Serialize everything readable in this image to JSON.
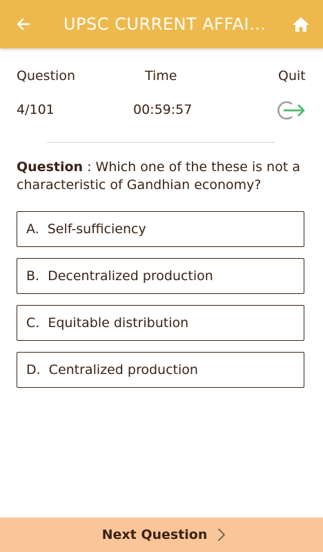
{
  "appbar": {
    "title": "UPSC CURRENT AFFAI...",
    "back_icon": "arrow-left-icon",
    "home_icon": "home-icon"
  },
  "stats": {
    "question_label": "Question",
    "time_label": "Time",
    "quit_label": "Quit",
    "question_value": "4/101",
    "time_value": "00:59:57",
    "quit_icon": "exit-arrow-icon"
  },
  "question": {
    "label": "Question",
    "separator": " : ",
    "text": "Which one of the these is not a characteristic of Gandhian economy?"
  },
  "options": [
    {
      "letter": "A.",
      "text": "Self-sufficiency"
    },
    {
      "letter": "B.",
      "text": "Decentralized production"
    },
    {
      "letter": "C.",
      "text": "Equitable distribution"
    },
    {
      "letter": "D.",
      "text": "Centralized production"
    }
  ],
  "footer": {
    "next_label": "Next Question",
    "next_icon": "chevron-right-icon"
  },
  "colors": {
    "appbar": "#eeb94c",
    "text": "#3b2314",
    "footer": "#fbc59a",
    "quit_arrow": "#4cbb6c",
    "quit_ring": "#9e9e9e"
  }
}
